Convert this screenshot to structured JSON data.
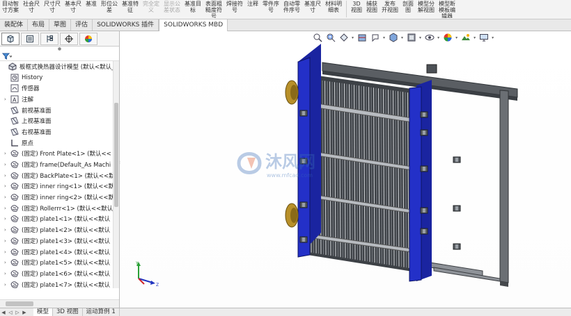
{
  "ribbon": {
    "buttons": [
      {
        "label": "目动智\n寸方案",
        "disabled": false
      },
      {
        "label": "社会尺\n寸",
        "disabled": false
      },
      {
        "label": "尺寸尺\n寸",
        "disabled": false
      },
      {
        "label": "基本尺\n寸",
        "disabled": false
      },
      {
        "label": "基准",
        "disabled": false
      },
      {
        "label": "形位公\n差",
        "disabled": false
      },
      {
        "label": "基准特\n征",
        "disabled": false
      },
      {
        "label": "完全定\n义",
        "disabled": true
      },
      {
        "label": "显示公\n差状态",
        "disabled": true
      },
      {
        "label": "基准目\n标",
        "disabled": false
      },
      {
        "label": "表面粗\n糙度符\n号",
        "disabled": false
      },
      {
        "label": "焊接符\n号",
        "disabled": false
      },
      {
        "label": "注释",
        "disabled": false
      },
      {
        "label": "零件序\n号",
        "disabled": false
      },
      {
        "label": "自动零\n件序号",
        "disabled": false
      },
      {
        "label": "基准尺\n寸",
        "disabled": false
      },
      {
        "label": "材料明\n细表",
        "disabled": false
      },
      {
        "label": "3D\n视图",
        "disabled": false
      },
      {
        "label": "捕获\n视图",
        "disabled": false
      },
      {
        "label": "发布\n开视图",
        "disabled": false
      },
      {
        "label": "剖面\n图",
        "disabled": false
      },
      {
        "label": "模型分\n解视图",
        "disabled": false
      },
      {
        "label": "模型断\n模板编\n辑器",
        "disabled": false
      }
    ]
  },
  "tabs": [
    {
      "label": "装配体",
      "active": false
    },
    {
      "label": "布局",
      "active": false
    },
    {
      "label": "草图",
      "active": false
    },
    {
      "label": "评估",
      "active": false
    },
    {
      "label": "SOLIDWORKS 插件",
      "active": false
    },
    {
      "label": "SOLIDWORKS MBD",
      "active": true
    }
  ],
  "panel": {
    "tab_icons": [
      "feature-manager-icon",
      "property-manager-icon",
      "configuration-manager-icon",
      "dimxpert-icon",
      "display-manager-icon"
    ],
    "filter_icon": "filter-icon"
  },
  "tree": {
    "root": {
      "label": "板框式换热器设计模型 (默认<默认_",
      "icon": "assembly-icon"
    },
    "items": [
      {
        "expand": "",
        "icon": "history-icon",
        "label": "History"
      },
      {
        "expand": "",
        "icon": "sensor-icon",
        "label": "传感器"
      },
      {
        "expand": "▶",
        "icon": "annotation-icon",
        "label": "注解"
      },
      {
        "expand": "",
        "icon": "plane-icon",
        "label": "前视基准面"
      },
      {
        "expand": "",
        "icon": "plane-icon",
        "label": "上视基准面"
      },
      {
        "expand": "",
        "icon": "plane-icon",
        "label": "右视基准面"
      },
      {
        "expand": "",
        "icon": "origin-icon",
        "label": "原点"
      },
      {
        "expand": "▶",
        "icon": "part-icon",
        "label": "(固定) Front Plate<1> (默认<<"
      },
      {
        "expand": "▶",
        "icon": "part-icon",
        "label": "(固定) frame(Default_As Machi"
      },
      {
        "expand": "▶",
        "icon": "part-icon",
        "label": "(固定) BackPlate<1> (默认<<默"
      },
      {
        "expand": "▶",
        "icon": "part-icon",
        "label": "(固定) inner ring<1> (默认<<默"
      },
      {
        "expand": "▶",
        "icon": "part-icon",
        "label": "(固定) inner ring<2> (默认<<默"
      },
      {
        "expand": "▶",
        "icon": "part-icon",
        "label": "(固定) Rollerrr<1> (默认<<默认"
      },
      {
        "expand": "▶",
        "icon": "part-icon",
        "label": "(固定) plate1<1> (默认<<默认"
      },
      {
        "expand": "▶",
        "icon": "part-icon",
        "label": "(固定) plate1<2> (默认<<默认"
      },
      {
        "expand": "▶",
        "icon": "part-icon",
        "label": "(固定) plate1<3> (默认<<默认"
      },
      {
        "expand": "▶",
        "icon": "part-icon",
        "label": "(固定) plate1<4> (默认<<默认"
      },
      {
        "expand": "▶",
        "icon": "part-icon",
        "label": "(固定) plate1<5> (默认<<默认"
      },
      {
        "expand": "▶",
        "icon": "part-icon",
        "label": "(固定) plate1<6> (默认<<默认"
      },
      {
        "expand": "▶",
        "icon": "part-icon",
        "label": "(固定) plate1<7> (默认<<默认"
      }
    ]
  },
  "bottom_tabs": [
    {
      "label": "模型",
      "active": true
    },
    {
      "label": "3D 视图",
      "active": false
    },
    {
      "label": "运动算例 1",
      "active": false
    }
  ],
  "viewport": {
    "watermark_text": "沐风网",
    "watermark_url": "www.mfcad.com",
    "colors": {
      "plate_blue": "#2330c8",
      "frame_gray": "#5a5e63",
      "accent_gold": "#b8902a"
    },
    "headsup_icons": [
      "zoom-to-fit-icon",
      "zoom-area-icon",
      "previous-view-icon",
      "section-view-icon",
      "dynamic-annotation-icon",
      "view-orientation-icon",
      "display-style-icon",
      "hide-show-icon",
      "appearance-icon",
      "scene-icon",
      "view-settings-icon"
    ]
  }
}
